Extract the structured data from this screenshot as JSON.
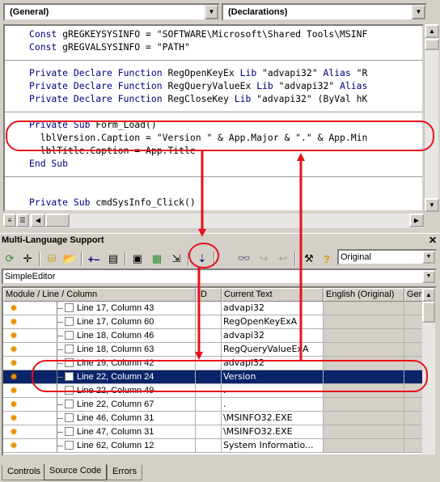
{
  "code_window": {
    "object_combo": "(General)",
    "procedure_combo": "(Declarations)",
    "lines": [
      {
        "text": "Const gREGKEYSYSINFO = \"SOFTWARE\\Microsoft\\Shared Tools\\MSINF"
      },
      {
        "text": "Const gREGVALSYSINFO = \"PATH\""
      },
      {
        "text": ""
      },
      {
        "text": "Private Declare Function RegOpenKeyEx Lib \"advapi32\" Alias \"R"
      },
      {
        "text": "Private Declare Function RegQueryValueEx Lib \"advapi32\" Alias"
      },
      {
        "text": "Private Declare Function RegCloseKey Lib \"advapi32\" (ByVal hK"
      },
      {
        "text": ""
      },
      {
        "text": "Private Sub Form_Load()"
      },
      {
        "text": "  lblVersion.Caption = \"Version \" & App.Major & \".\" & App.Min"
      },
      {
        "text": "  lblTitle.Caption = App.Title"
      },
      {
        "text": "End Sub"
      },
      {
        "text": ""
      },
      {
        "text": ""
      },
      {
        "text": "Private Sub cmdSysInfo_Click()"
      }
    ]
  },
  "mls_panel": {
    "title": "Multi-Language Support",
    "language_combo": "Original",
    "editor_combo": "SimpleEditor",
    "columns": [
      "Module / Line / Column",
      "ID",
      "Current Text",
      "English (Original)",
      "Germ"
    ],
    "rows": [
      {
        "location": "Line 17, Column 43",
        "id": "",
        "text": "advapi32",
        "selected": false
      },
      {
        "location": "Line 17, Column 60",
        "id": "",
        "text": "RegOpenKeyExA",
        "selected": false
      },
      {
        "location": "Line 18, Column 46",
        "id": "",
        "text": "advapi32",
        "selected": false
      },
      {
        "location": "Line 18, Column 63",
        "id": "",
        "text": "RegQueryValueExA",
        "selected": false
      },
      {
        "location": "Line 19, Column 42",
        "id": "",
        "text": "advapi32",
        "selected": false
      },
      {
        "location": "Line 22, Column 24",
        "id": "",
        "text": "Version",
        "selected": true
      },
      {
        "location": "Line 22, Column 49",
        "id": "",
        "text": ".",
        "selected": false
      },
      {
        "location": "Line 22, Column 67",
        "id": "",
        "text": ".",
        "selected": false
      },
      {
        "location": "Line 46, Column 31",
        "id": "",
        "text": "\\MSINFO32.EXE",
        "selected": false
      },
      {
        "location": "Line 47, Column 31",
        "id": "",
        "text": "\\MSINFO32.EXE",
        "selected": false
      },
      {
        "location": "Line 62, Column 12",
        "id": "",
        "text": "System Informatio...",
        "selected": false
      }
    ],
    "tabs": [
      "Controls",
      "Source Code",
      "Errors"
    ],
    "active_tab": "Source Code"
  },
  "colors": {
    "selection": "#0a246a",
    "annotation": "#e8101c",
    "keyword": "#00007f"
  }
}
